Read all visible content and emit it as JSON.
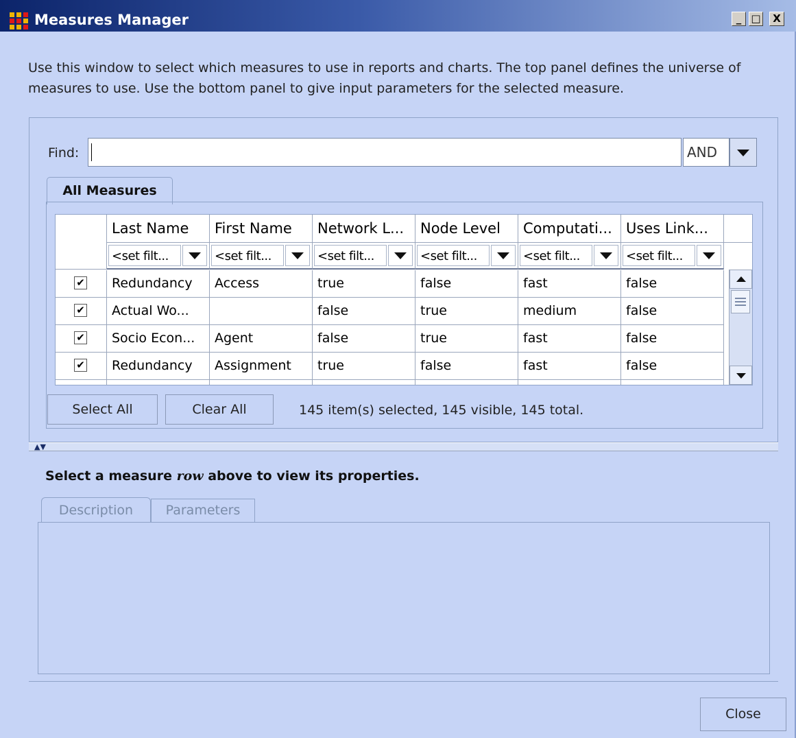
{
  "window": {
    "title": "Measures Manager",
    "controls": {
      "minimize": "_",
      "maximize": "□",
      "close": "X"
    }
  },
  "intro": {
    "line1": "Use this window to select which measures to use in reports and charts. The top panel defines the universe of",
    "line2": "measures to use. Use the bottom panel to give input parameters for the selected measure."
  },
  "find": {
    "label": "Find:",
    "value": "",
    "operator": "AND"
  },
  "tabs": {
    "all_measures": "All Measures"
  },
  "table": {
    "columns": [
      "Last Name",
      "First Name",
      "Network L...",
      "Node Level",
      "Computati...",
      "Uses Link..."
    ],
    "filter_placeholder": "<set filt...",
    "rows": [
      {
        "checked": true,
        "cells": [
          "Redundancy",
          "Access",
          "true",
          "false",
          "fast",
          "false"
        ]
      },
      {
        "checked": true,
        "cells": [
          "Actual Wo...",
          "",
          "false",
          "true",
          "medium",
          "false"
        ]
      },
      {
        "checked": true,
        "cells": [
          "Socio Econ...",
          "Agent",
          "false",
          "true",
          "fast",
          "false"
        ]
      },
      {
        "checked": true,
        "cells": [
          "Redundancy",
          "Assignment",
          "true",
          "false",
          "fast",
          "false"
        ]
      }
    ]
  },
  "actions": {
    "select_all": "Select All",
    "clear_all": "Clear All",
    "status": "145 item(s) selected, 145 visible, 145 total."
  },
  "properties": {
    "hint_prefix": "Select a measure ",
    "hint_em": "row",
    "hint_suffix": " above to view its properties.",
    "tab_description": "Description",
    "tab_parameters": "Parameters"
  },
  "footer": {
    "close": "Close"
  },
  "colors": {
    "window_bg": "#c6d4f6",
    "title_start": "#0c246a",
    "title_end": "#a6bce6",
    "app_icon": "#f0b400"
  },
  "icons": [
    "app-grid-icon",
    "dropdown-arrow-icon",
    "checkbox-checked-icon",
    "scroll-up-icon",
    "scroll-down-icon",
    "splitter-arrows-icon"
  ]
}
